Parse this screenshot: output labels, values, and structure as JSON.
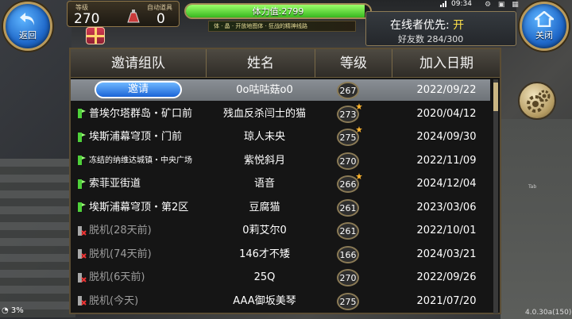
{
  "top": {
    "back_label": "返回",
    "close_label": "关闭",
    "level_caption": "等级",
    "level_value": "270",
    "item_caption": "自动道具",
    "item_value": "0",
    "stamina_text": "体力值:2799",
    "stamina_fraction": 0.97,
    "buff_text": "体 · 晶 · 开放地图体 · 狂战的精神线路",
    "clock": "09:34",
    "online_label": "在线者优先: ",
    "online_state": "开",
    "friends_count": "好友数 284/300",
    "version": "4.0.30a(150)",
    "battery": "3%",
    "tab_hint": "Tab"
  },
  "table": {
    "headers": [
      "邀请组队",
      "姓名",
      "等级",
      "加入日期"
    ],
    "invite_label": "邀请",
    "rows": [
      {
        "location": "",
        "invite": true,
        "name": "0o咕咕菇o0",
        "level": "267",
        "date": "2022/09/22",
        "status": "selected",
        "star": false
      },
      {
        "location": "普埃尔塔群岛・矿口前",
        "name": "残血反杀闫士的猫",
        "level": "273",
        "date": "2020/04/12",
        "status": "online",
        "star": true
      },
      {
        "location": "埃斯浦幕穹顶・门前",
        "name": "琼人未央",
        "level": "275",
        "date": "2024/09/30",
        "status": "online",
        "star": true
      },
      {
        "location": "冻结的纳维达城镇・中央广场",
        "name": "紫悦斜月",
        "level": "270",
        "date": "2022/11/09",
        "status": "online",
        "small": true,
        "star": false
      },
      {
        "location": "索菲亚街道",
        "name": "语音",
        "level": "266",
        "date": "2024/12/04",
        "status": "online",
        "star": true
      },
      {
        "location": "埃斯浦幕穹顶・第2区",
        "name": "豆腐猫",
        "level": "261",
        "date": "2023/03/06",
        "status": "online",
        "star": false
      },
      {
        "location": "脱机(28天前)",
        "name": "0莉艾尔0",
        "level": "261",
        "date": "2022/10/01",
        "status": "offline",
        "star": false
      },
      {
        "location": "脱机(74天前)",
        "name": "146才不矮",
        "level": "166",
        "date": "2024/03/21",
        "status": "offline",
        "star": false
      },
      {
        "location": "脱机(6天前)",
        "name": "25Q",
        "level": "270",
        "date": "2022/09/26",
        "status": "offline",
        "star": false
      },
      {
        "location": "脱机(今天)",
        "name": "AAA御坂美琴",
        "level": "275",
        "date": "2021/07/20",
        "status": "offline",
        "star": false
      }
    ]
  },
  "colors": {
    "panel_bg": "#151515",
    "selected_row": "#7d8287",
    "online_on": "#ffe24a",
    "offline_text": "#9d9d9d",
    "invite_button": "#2a78e6",
    "stamina_fill": "#5fdc3b"
  },
  "icons": {
    "back": "return-arrow-icon",
    "close": "home-icon",
    "gear": "gear-icon",
    "online_pin": "green-map-pin-icon",
    "offline_pin": "red-x-pin-icon",
    "gift": "gift-box-icon",
    "potion": "potion-icon",
    "star": "star-icon"
  }
}
